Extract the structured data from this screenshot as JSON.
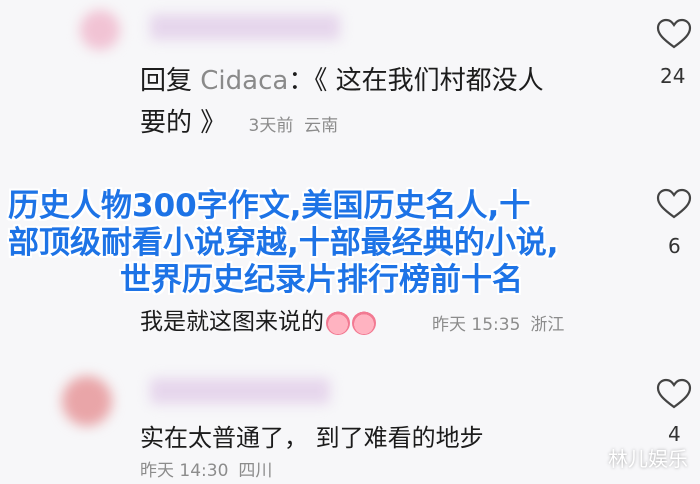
{
  "comments": [
    {
      "reply_prefix": "回复",
      "reply_to": "Cidaca",
      "text_line1": "：《 这在我们村都没人",
      "text_line2": "要的 》",
      "time": "3天前",
      "location": "云南",
      "likes": "24"
    },
    {
      "text": "我是就这图来说的",
      "time": "昨天 15:35",
      "location": "浙江",
      "likes": "6"
    },
    {
      "text": "实在太普通了，  到了难看的地步",
      "time": "昨天 14:30",
      "location": "四川",
      "likes": "4"
    }
  ],
  "overlay": {
    "line1": "历史人物300字作文,美国历史名人,十",
    "line2": "部顶级耐看小说穿越,十部最经典的小说,",
    "line3": "世界历史纪录片排行榜前十名"
  },
  "watermark": "林儿娱乐",
  "colors": {
    "overlay_text": "#1d73e6",
    "meta": "#8c8c8c"
  }
}
